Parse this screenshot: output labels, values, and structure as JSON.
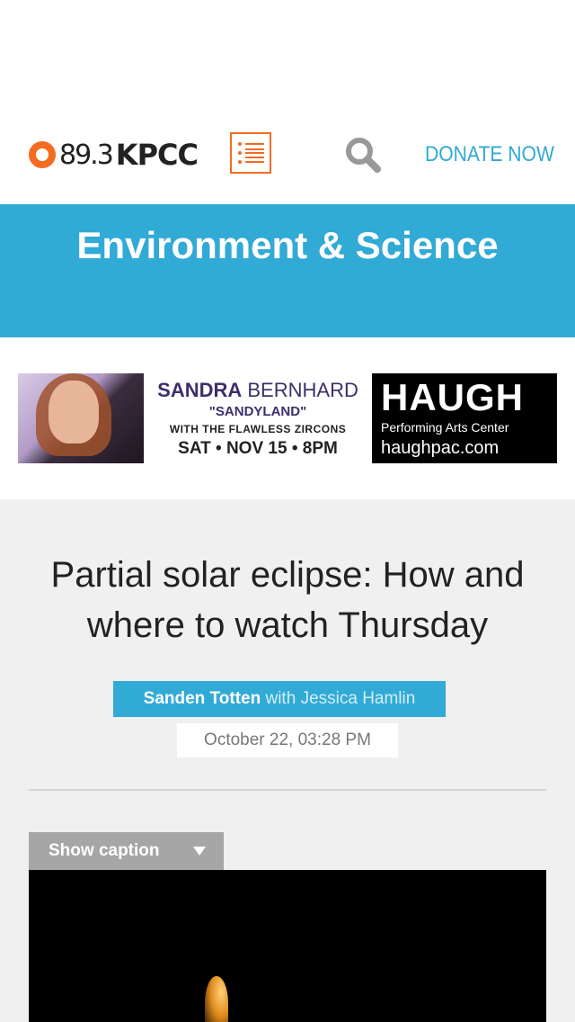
{
  "header": {
    "logo_frequency": "89.3",
    "logo_callsign": "KPCC",
    "donate_label": "DONATE NOW",
    "menu_icon": "list-menu-icon",
    "search_icon": "search-icon"
  },
  "section": {
    "title": "Environment & Science"
  },
  "ad": {
    "headliner_bold": "SANDRA",
    "headliner_light": " BERNHARD",
    "show_title": "\"SANDYLAND\"",
    "support": "WITH THE FLAWLESS ZIRCONS",
    "date": "SAT • NOV 15 • 8PM",
    "venue": "HAUGH",
    "venue_sub": "Performing Arts Center",
    "venue_url": "haughpac.com"
  },
  "article": {
    "headline": "Partial solar eclipse: How and where to watch Thursday",
    "author": "Sanden Totten",
    "with_text": " with ",
    "coauthor": "Jessica Hamlin",
    "timestamp": "October 22, 03:28 PM",
    "caption_toggle": "Show caption"
  },
  "colors": {
    "accent_orange": "#f36c21",
    "section_blue": "#31aad6",
    "article_bg": "#f0f0f0"
  }
}
